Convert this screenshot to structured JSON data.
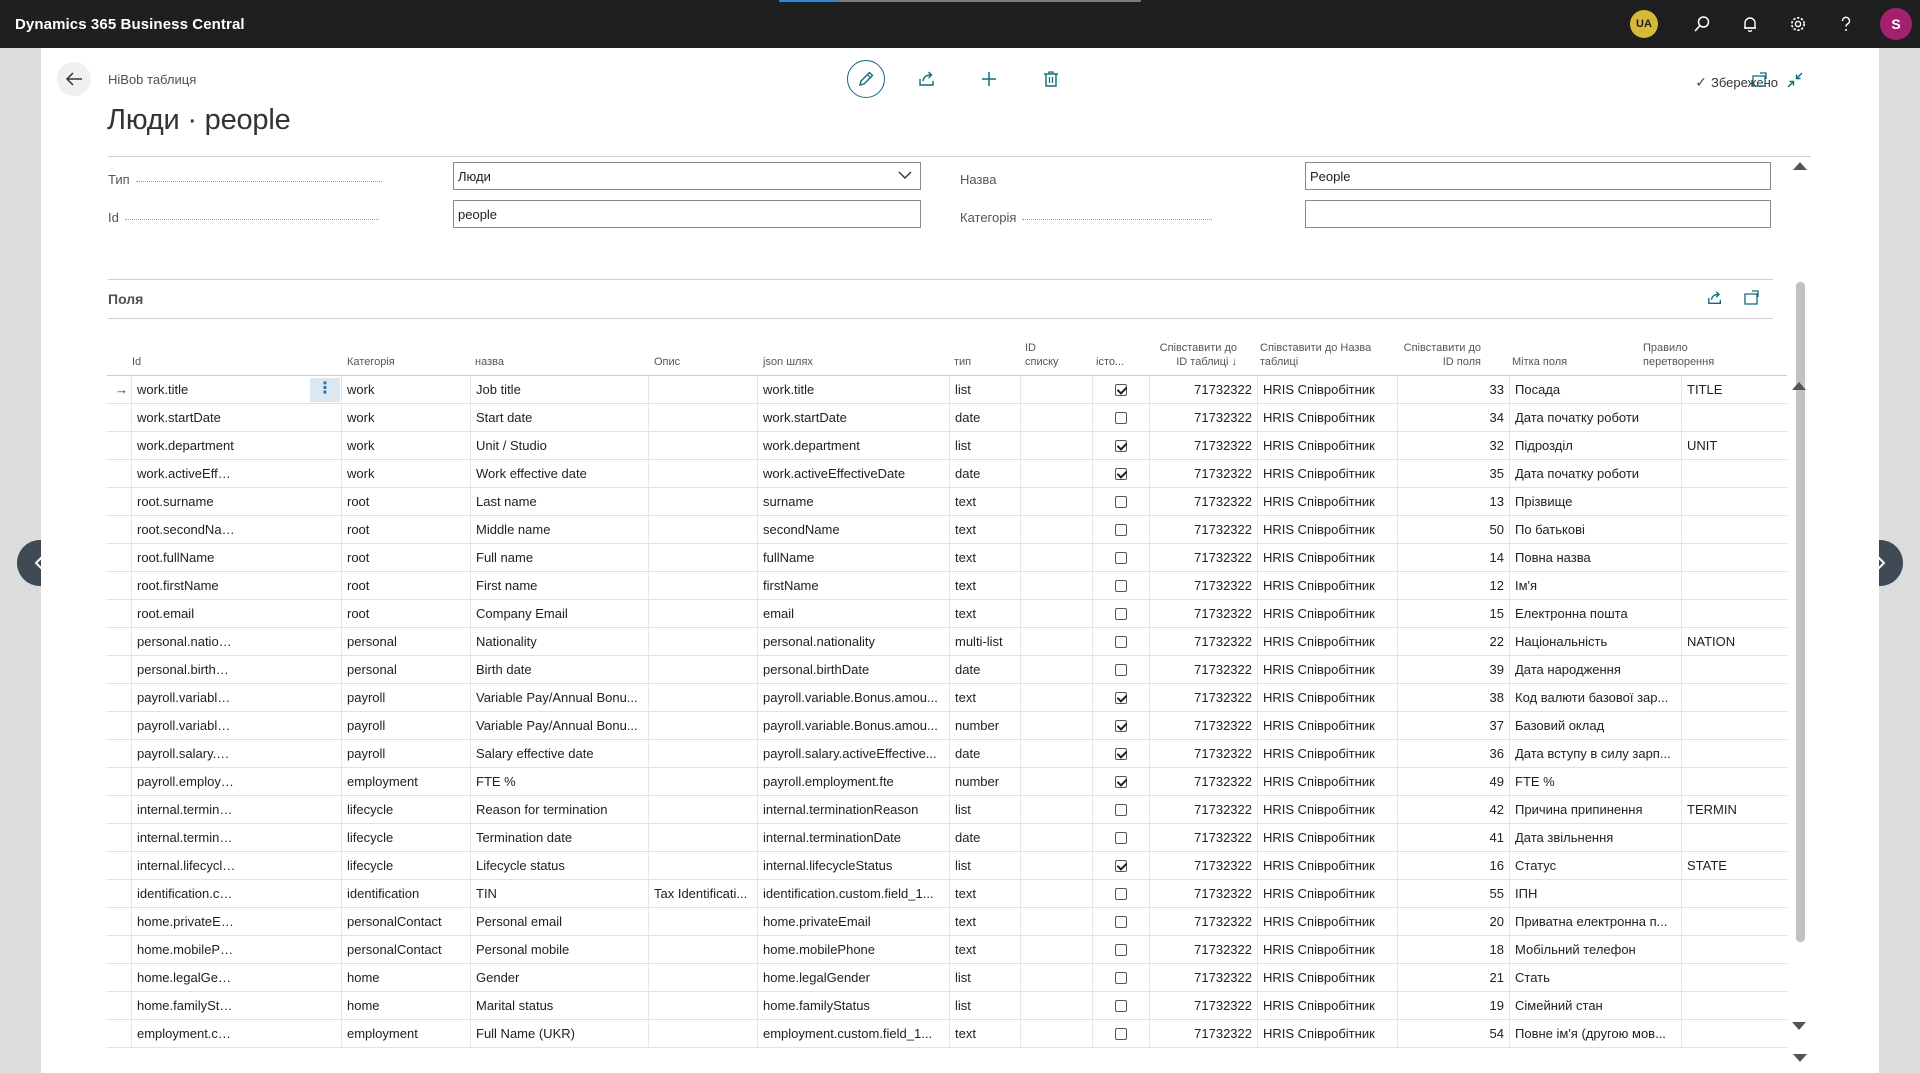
{
  "app": {
    "title": "Dynamics 365 Business Central",
    "progress_percent": 16,
    "locale_badge": "UA",
    "user_initial": "S"
  },
  "page": {
    "breadcrumb": "HiBob таблиця",
    "title": "Люди · people",
    "saved_label": "Збережено"
  },
  "form": {
    "type_label": "Тип",
    "type_value": "Люди",
    "id_label": "Id",
    "id_value": "people",
    "name_label": "Назва",
    "name_value": "People",
    "category_label": "Категорія",
    "category_value": ""
  },
  "fields_section": {
    "title": "Поля"
  },
  "table": {
    "headers": {
      "id": "Id",
      "category": "Категорія",
      "name": "назва",
      "description": "Опис",
      "json_path": "json шлях",
      "type": "тип",
      "list_id_1": "ID",
      "list_id_2": "списку",
      "hist": "істо...",
      "map_table_id_1": "Співставити до",
      "map_table_id_2": "ID таблиці ↓",
      "map_table_name_1": "Співставити до Назва",
      "map_table_name_2": "таблиці",
      "map_field_id_1": "Співставити до",
      "map_field_id_2": "ID поля",
      "field_label": "Мітка поля",
      "rule_1": "Правило",
      "rule_2": "перетворення"
    },
    "rows": [
      {
        "id": "work.title",
        "category": "work",
        "name": "Job title",
        "desc": "",
        "json": "work.title",
        "type": "list",
        "list_id": "",
        "hist": true,
        "table_id": "71732322",
        "table_name": "HRIS Співробітник",
        "field_id": "33",
        "label": "Посада",
        "rule": "TITLE"
      },
      {
        "id": "work.startDate",
        "category": "work",
        "name": "Start date",
        "desc": "",
        "json": "work.startDate",
        "type": "date",
        "list_id": "",
        "hist": false,
        "table_id": "71732322",
        "table_name": "HRIS Співробітник",
        "field_id": "34",
        "label": "Дата початку роботи",
        "rule": ""
      },
      {
        "id": "work.department",
        "category": "work",
        "name": "Unit / Studio",
        "desc": "",
        "json": "work.department",
        "type": "list",
        "list_id": "",
        "hist": true,
        "table_id": "71732322",
        "table_name": "HRIS Співробітник",
        "field_id": "32",
        "label": "Підрозділ",
        "rule": "UNIT"
      },
      {
        "id": "work.activeEffectiv...",
        "category": "work",
        "name": "Work effective date",
        "desc": "",
        "json": "work.activeEffectiveDate",
        "type": "date",
        "list_id": "",
        "hist": true,
        "table_id": "71732322",
        "table_name": "HRIS Співробітник",
        "field_id": "35",
        "label": "Дата початку роботи",
        "rule": ""
      },
      {
        "id": "root.surname",
        "category": "root",
        "name": "Last name",
        "desc": "",
        "json": "surname",
        "type": "text",
        "list_id": "",
        "hist": false,
        "table_id": "71732322",
        "table_name": "HRIS Співробітник",
        "field_id": "13",
        "label": "Прізвище",
        "rule": ""
      },
      {
        "id": "root.secondName",
        "category": "root",
        "name": "Middle name",
        "desc": "",
        "json": "secondName",
        "type": "text",
        "list_id": "",
        "hist": false,
        "table_id": "71732322",
        "table_name": "HRIS Співробітник",
        "field_id": "50",
        "label": "По батькові",
        "rule": ""
      },
      {
        "id": "root.fullName",
        "category": "root",
        "name": "Full name",
        "desc": "",
        "json": "fullName",
        "type": "text",
        "list_id": "",
        "hist": false,
        "table_id": "71732322",
        "table_name": "HRIS Співробітник",
        "field_id": "14",
        "label": "Повна назва",
        "rule": ""
      },
      {
        "id": "root.firstName",
        "category": "root",
        "name": "First name",
        "desc": "",
        "json": "firstName",
        "type": "text",
        "list_id": "",
        "hist": false,
        "table_id": "71732322",
        "table_name": "HRIS Співробітник",
        "field_id": "12",
        "label": "Ім'я",
        "rule": ""
      },
      {
        "id": "root.email",
        "category": "root",
        "name": "Company Email",
        "desc": "",
        "json": "email",
        "type": "text",
        "list_id": "",
        "hist": false,
        "table_id": "71732322",
        "table_name": "HRIS Співробітник",
        "field_id": "15",
        "label": "Електронна пошта",
        "rule": ""
      },
      {
        "id": "personal.nationality",
        "category": "personal",
        "name": "Nationality",
        "desc": "",
        "json": "personal.nationality",
        "type": "multi-list",
        "list_id": "",
        "hist": false,
        "table_id": "71732322",
        "table_name": "HRIS Співробітник",
        "field_id": "22",
        "label": "Національність",
        "rule": "NATION"
      },
      {
        "id": "personal.birthDate",
        "category": "personal",
        "name": "Birth date",
        "desc": "",
        "json": "personal.birthDate",
        "type": "date",
        "list_id": "",
        "hist": false,
        "table_id": "71732322",
        "table_name": "HRIS Співробітник",
        "field_id": "39",
        "label": "Дата народження",
        "rule": ""
      },
      {
        "id": "payroll.variable.Bo...",
        "category": "payroll",
        "name": "Variable Pay/Annual Bonu...",
        "desc": "",
        "json": "payroll.variable.Bonus.amou...",
        "type": "text",
        "list_id": "",
        "hist": true,
        "table_id": "71732322",
        "table_name": "HRIS Співробітник",
        "field_id": "38",
        "label": "Код валюти базової зар...",
        "rule": ""
      },
      {
        "id": "payroll.variable.Bo...",
        "category": "payroll",
        "name": "Variable Pay/Annual Bonu...",
        "desc": "",
        "json": "payroll.variable.Bonus.amou...",
        "type": "number",
        "list_id": "",
        "hist": true,
        "table_id": "71732322",
        "table_name": "HRIS Співробітник",
        "field_id": "37",
        "label": "Базовий оклад",
        "rule": ""
      },
      {
        "id": "payroll.salary.activ...",
        "category": "payroll",
        "name": "Salary effective date",
        "desc": "",
        "json": "payroll.salary.activeEffective...",
        "type": "date",
        "list_id": "",
        "hist": true,
        "table_id": "71732322",
        "table_name": "HRIS Співробітник",
        "field_id": "36",
        "label": "Дата вступу в силу зарп...",
        "rule": ""
      },
      {
        "id": "payroll.employme...",
        "category": "employment",
        "name": "FTE %",
        "desc": "",
        "json": "payroll.employment.fte",
        "type": "number",
        "list_id": "",
        "hist": true,
        "table_id": "71732322",
        "table_name": "HRIS Співробітник",
        "field_id": "49",
        "label": "FTE %",
        "rule": ""
      },
      {
        "id": "internal.terminatio...",
        "category": "lifecycle",
        "name": "Reason for termination",
        "desc": "",
        "json": "internal.terminationReason",
        "type": "list",
        "list_id": "",
        "hist": false,
        "table_id": "71732322",
        "table_name": "HRIS Співробітник",
        "field_id": "42",
        "label": "Причина припинення",
        "rule": "TERMIN"
      },
      {
        "id": "internal.terminatio...",
        "category": "lifecycle",
        "name": "Termination date",
        "desc": "",
        "json": "internal.terminationDate",
        "type": "date",
        "list_id": "",
        "hist": false,
        "table_id": "71732322",
        "table_name": "HRIS Співробітник",
        "field_id": "41",
        "label": "Дата звільнення",
        "rule": ""
      },
      {
        "id": "internal.lifecycleSt...",
        "category": "lifecycle",
        "name": "Lifecycle status",
        "desc": "",
        "json": "internal.lifecycleStatus",
        "type": "list",
        "list_id": "",
        "hist": true,
        "table_id": "71732322",
        "table_name": "HRIS Співробітник",
        "field_id": "16",
        "label": "Статус",
        "rule": "STATE"
      },
      {
        "id": "identification.cust...",
        "category": "identification",
        "name": "TIN",
        "desc": "Tax Identificati...",
        "json": "identification.custom.field_1...",
        "type": "text",
        "list_id": "",
        "hist": false,
        "table_id": "71732322",
        "table_name": "HRIS Співробітник",
        "field_id": "55",
        "label": "ІПН",
        "rule": ""
      },
      {
        "id": "home.privateEmail",
        "category": "personalContact",
        "name": "Personal email",
        "desc": "",
        "json": "home.privateEmail",
        "type": "text",
        "list_id": "",
        "hist": false,
        "table_id": "71732322",
        "table_name": "HRIS Співробітник",
        "field_id": "20",
        "label": "Приватна електронна п...",
        "rule": ""
      },
      {
        "id": "home.mobilePhone",
        "category": "personalContact",
        "name": "Personal mobile",
        "desc": "",
        "json": "home.mobilePhone",
        "type": "text",
        "list_id": "",
        "hist": false,
        "table_id": "71732322",
        "table_name": "HRIS Співробітник",
        "field_id": "18",
        "label": "Мобільний телефон",
        "rule": ""
      },
      {
        "id": "home.legalGender",
        "category": "home",
        "name": "Gender",
        "desc": "",
        "json": "home.legalGender",
        "type": "list",
        "list_id": "",
        "hist": false,
        "table_id": "71732322",
        "table_name": "HRIS Співробітник",
        "field_id": "21",
        "label": "Стать",
        "rule": ""
      },
      {
        "id": "home.familyStatus",
        "category": "home",
        "name": "Marital status",
        "desc": "",
        "json": "home.familyStatus",
        "type": "list",
        "list_id": "",
        "hist": false,
        "table_id": "71732322",
        "table_name": "HRIS Співробітник",
        "field_id": "19",
        "label": "Сімейний стан",
        "rule": ""
      },
      {
        "id": "employment.custo...",
        "category": "employment",
        "name": "Full Name (UKR)",
        "desc": "",
        "json": "employment.custom.field_1...",
        "type": "text",
        "list_id": "",
        "hist": false,
        "table_id": "71732322",
        "table_name": "HRIS Співробітник",
        "field_id": "54",
        "label": "Повне ім'я (другою мов...",
        "rule": ""
      }
    ]
  },
  "icons": {
    "search": "search-icon",
    "bell": "bell-icon",
    "gear": "gear-icon",
    "help": "help-icon",
    "back": "back-arrow-icon",
    "edit": "pencil-icon",
    "share": "share-icon",
    "add": "plus-icon",
    "delete": "trash-icon",
    "open_new": "open-in-new-window-icon",
    "collapse": "collapse-icon",
    "row_selected": "row-arrow-icon",
    "row_menu": "ellipsis-vertical-icon"
  },
  "colors": {
    "topbar": "#1f1f1f",
    "accent": "#0f6a7b",
    "progress": "#2b88d8",
    "badge": "#d6b93b",
    "avatar": "#a4206e"
  }
}
